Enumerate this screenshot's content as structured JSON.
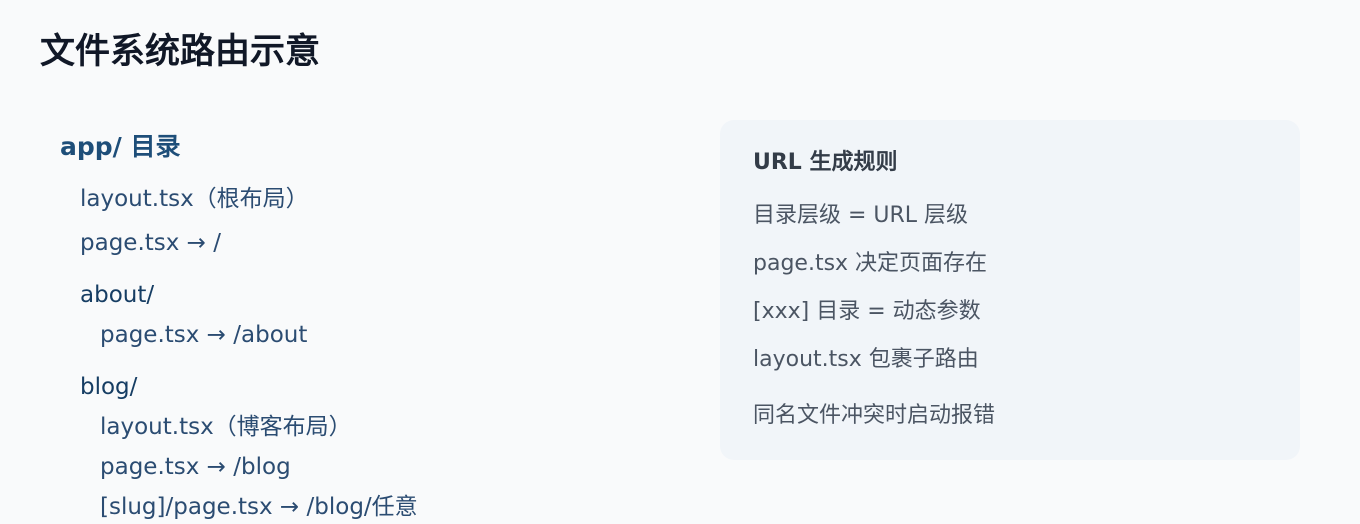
{
  "page": {
    "title": "文件系统路由示意"
  },
  "tree": {
    "root": "app/ 目录",
    "lines": [
      "layout.tsx（根布局）",
      "page.tsx → /",
      "about/",
      "page.tsx → /about",
      "blog/",
      "layout.tsx（博客布局）",
      "page.tsx → /blog",
      "[slug]/page.tsx → /blog/任意"
    ]
  },
  "rules": {
    "title": "URL 生成规则",
    "items": [
      "目录层级 = URL 层级",
      "page.tsx 决定页面存在",
      "[xxx] 目录 = 动态参数",
      "layout.tsx 包裹子路由",
      "同名文件冲突时启动报错"
    ]
  }
}
